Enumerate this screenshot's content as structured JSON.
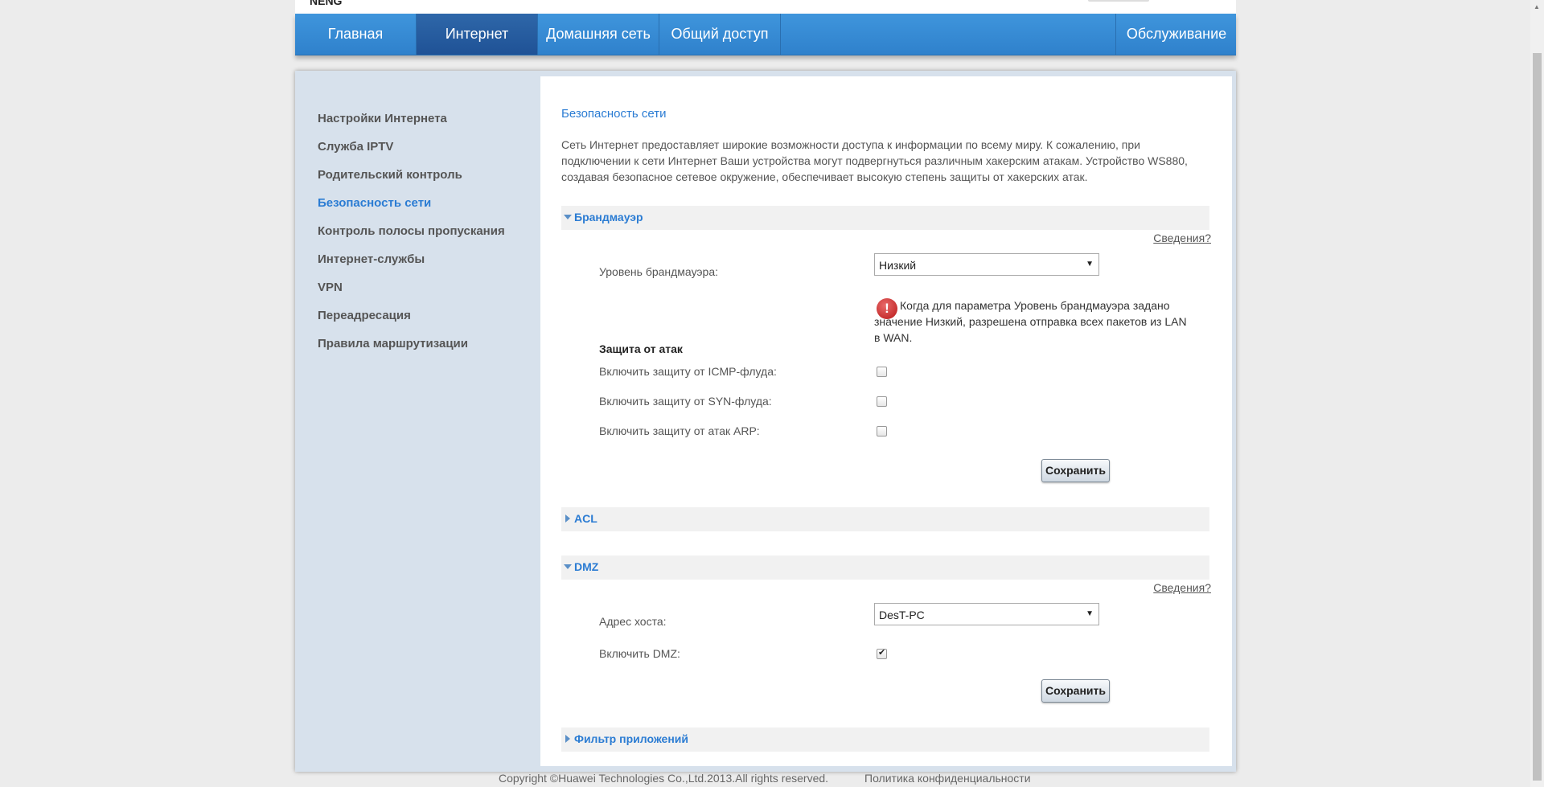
{
  "header": {
    "logo_fragment": "NENG",
    "tabs": [
      {
        "label": "Главная"
      },
      {
        "label": "Интернет"
      },
      {
        "label": "Домашняя сеть"
      },
      {
        "label": "Общий доступ"
      }
    ],
    "right_tab": "Обслуживание"
  },
  "sidebar": {
    "items": [
      {
        "label": "Настройки Интернета"
      },
      {
        "label": "Служба IPTV"
      },
      {
        "label": "Родительский контроль"
      },
      {
        "label": "Безопасность сети"
      },
      {
        "label": "Контроль полосы пропускания"
      },
      {
        "label": "Интернет-службы"
      },
      {
        "label": "VPN"
      },
      {
        "label": "Переадресация"
      },
      {
        "label": "Правила маршрутизации"
      }
    ],
    "active": "Безопасность сети"
  },
  "main": {
    "title": "Безопасность сети",
    "description": "Сеть Интернет предоставляет широкие возможности доступа к информации по всему миру. К сожалению, при подключении к сети Интернет Ваши устройства могут подвергнуться различным хакерским атакам. Устройство WS880, создавая безопасное сетевое окружение, обеспечивает высокую степень защиты от хакерских атак.",
    "help_label": "Сведения?",
    "firewall": {
      "header": "Брандмауэр",
      "level_label": "Уровень брандмауэра:",
      "level_value": "Низкий",
      "warning": "Когда для параметра Уровень брандмауэра задано значение Низкий, разрешена отправка всех пакетов из LAN в WAN.",
      "attack_title": "Защита от атак",
      "icmp_label": "Включить защиту от ICMP-флуда:",
      "icmp_checked": false,
      "syn_label": "Включить защиту от SYN-флуда:",
      "syn_checked": false,
      "arp_label": "Включить защиту от атак ARP:",
      "arp_checked": false,
      "save_label": "Сохранить"
    },
    "acl": {
      "header": "ACL"
    },
    "dmz": {
      "header": "DMZ",
      "host_label": "Адрес хоста:",
      "host_value": "DesT-PC",
      "enable_label": "Включить DMZ:",
      "enable_checked": true,
      "save_label": "Сохранить"
    },
    "app_filter": {
      "header": "Фильтр приложений"
    }
  },
  "footer": {
    "copyright": "Copyright ©Huawei Technologies Co.,Ltd.2013.All rights reserved.",
    "policy": "Политика конфиденциальности"
  },
  "colors": {
    "accent": "#2b7cd3",
    "nav_bg": "#3a8fd9",
    "nav_active": "#1f5296",
    "panel_bg": "#d7e1ec"
  },
  "icons": [
    "triangle-down-icon",
    "triangle-right-icon",
    "exclamation-icon",
    "dropdown-caret-icon",
    "check-icon"
  ]
}
